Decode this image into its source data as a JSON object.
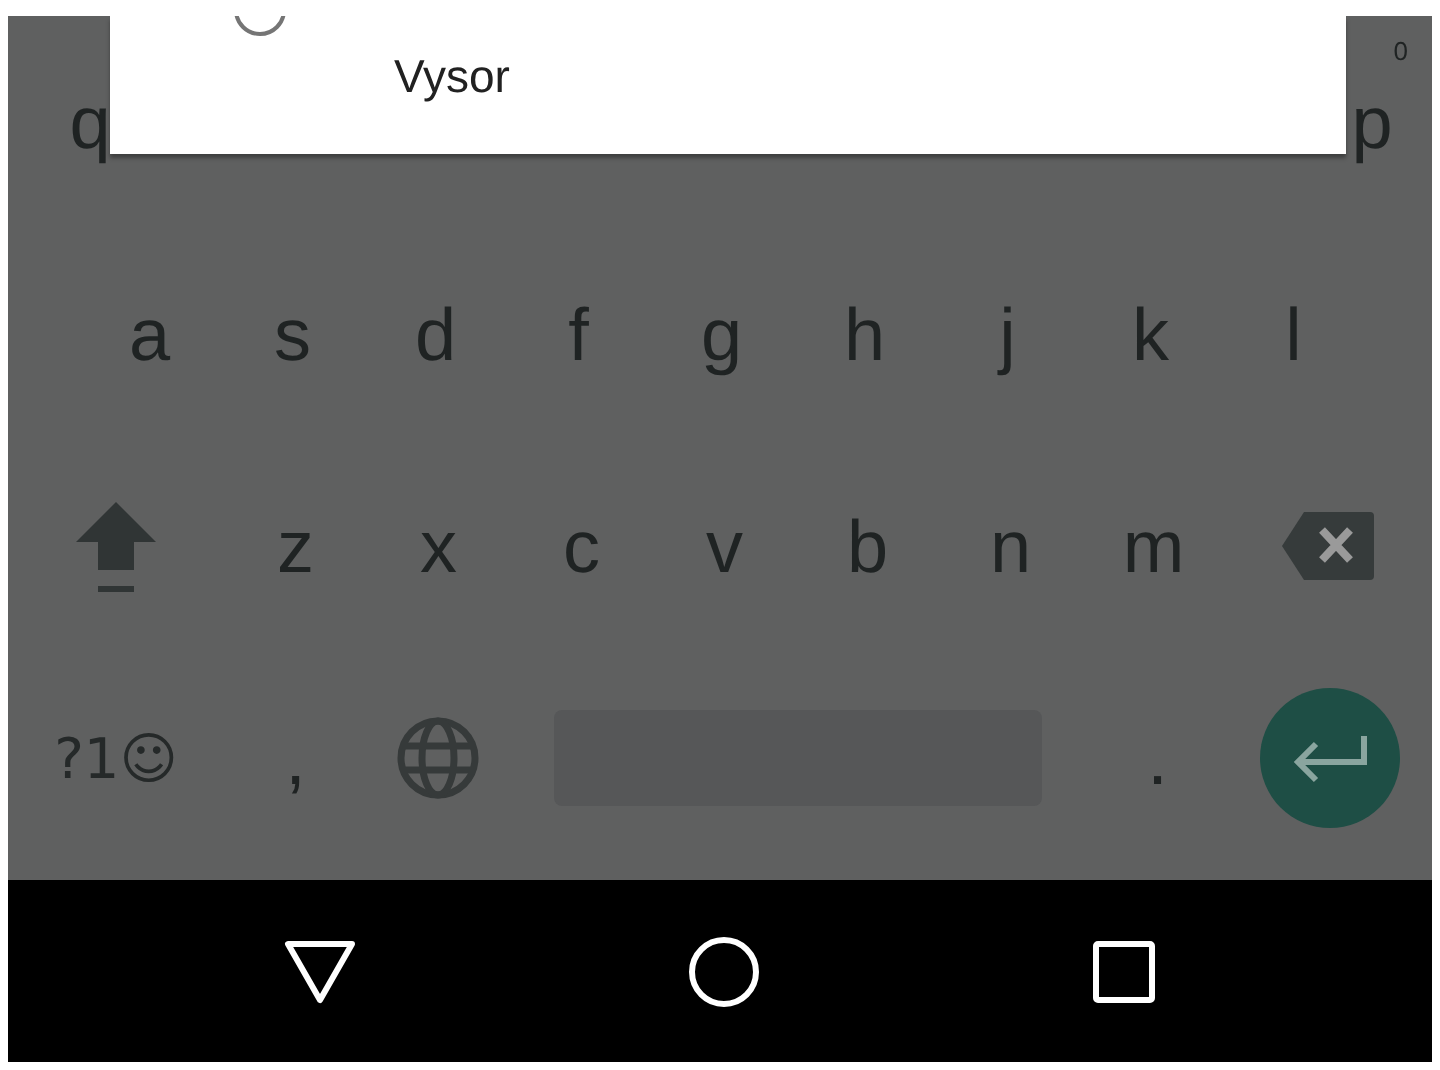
{
  "dialog": {
    "options": [
      {
        "label": "Vysor",
        "selected": false
      }
    ]
  },
  "keyboard": {
    "top_row": [
      {
        "label": "q"
      },
      {
        "label": "p",
        "hint": "0"
      }
    ],
    "letter_rows": [
      [
        "a",
        "s",
        "d",
        "f",
        "g",
        "h",
        "j",
        "k",
        "l"
      ],
      [
        "z",
        "x",
        "c",
        "v",
        "b",
        "n",
        "m"
      ]
    ],
    "symbols_key": "?1☺",
    "comma_key": ",",
    "period_key": "."
  }
}
